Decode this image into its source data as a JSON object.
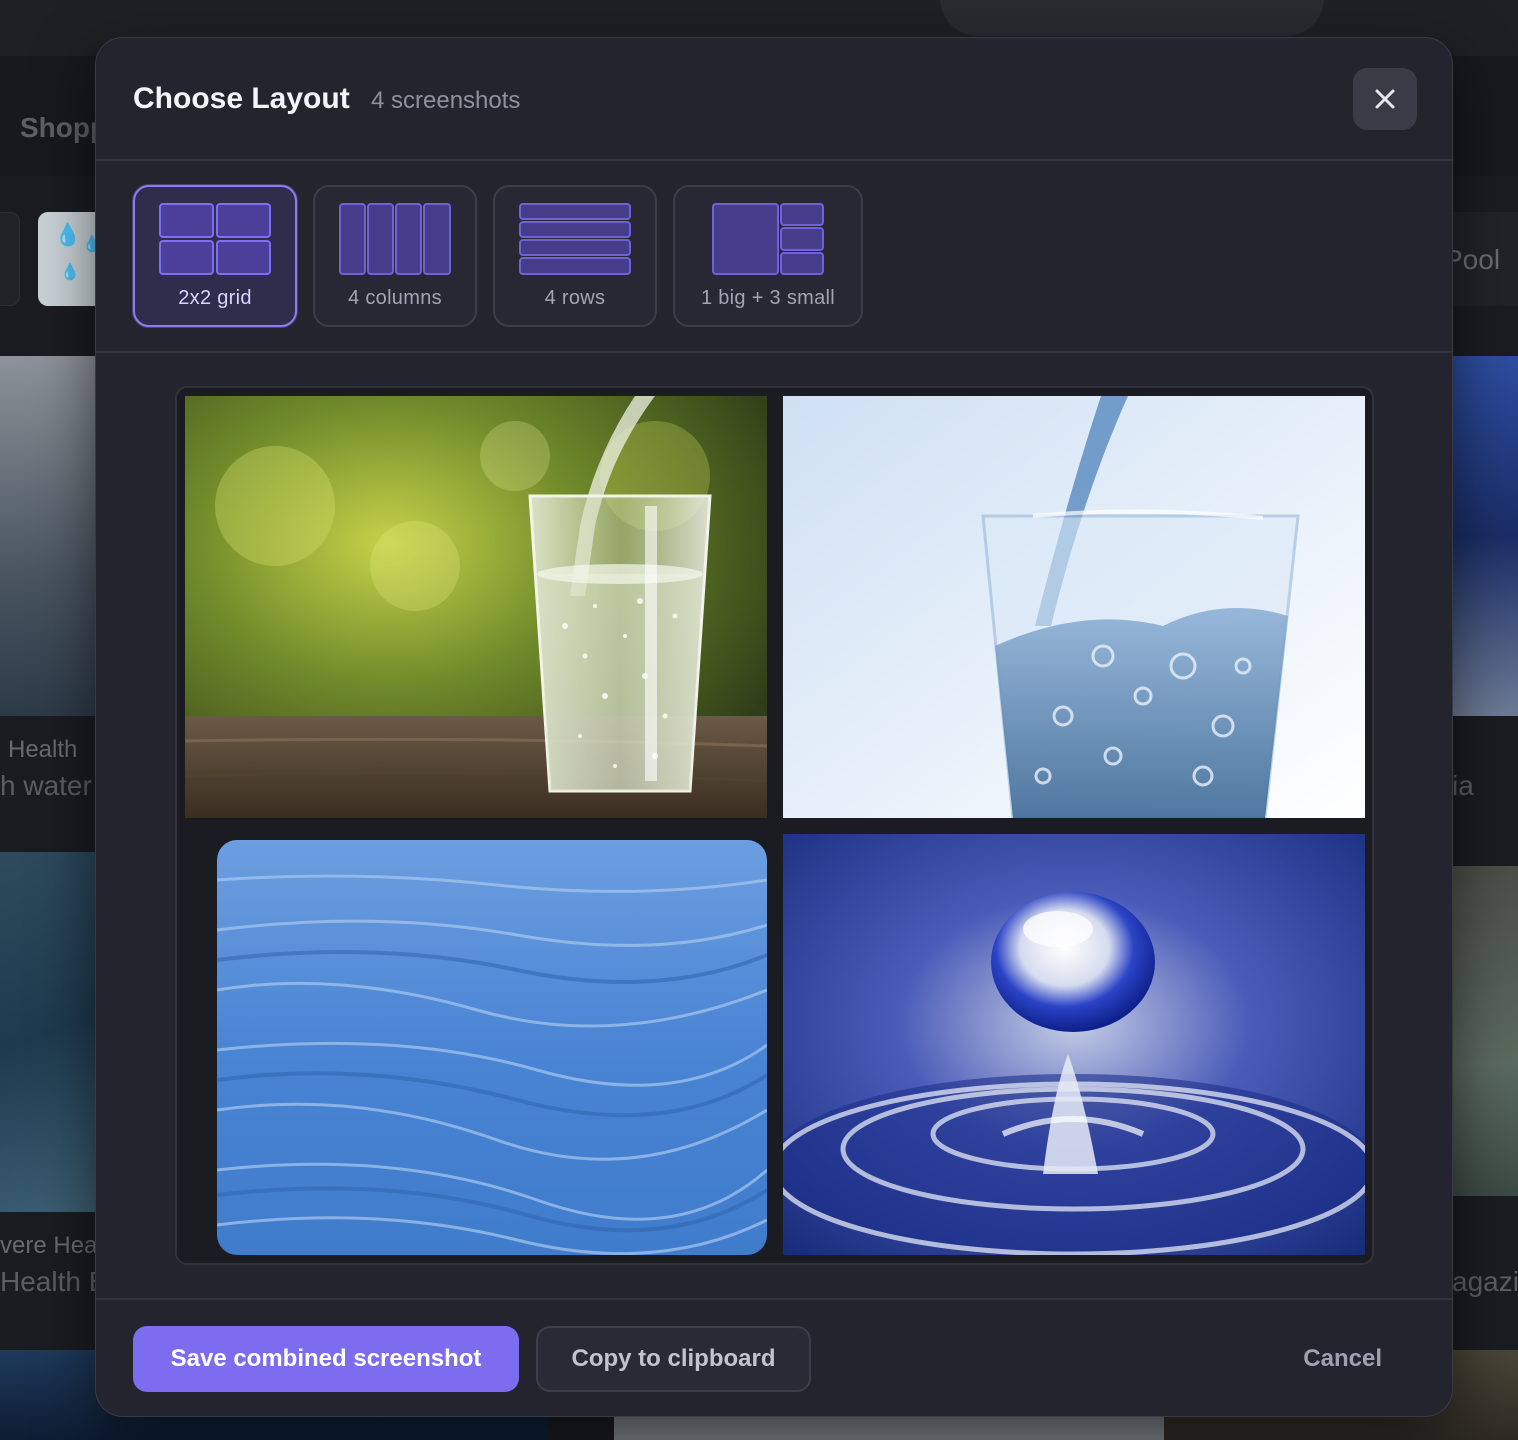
{
  "background": {
    "nav_label": "Shopp",
    "chip_right_label": "Pool",
    "card_left_1_category": "Health",
    "card_left_1_title": "h water",
    "card_right_1_title": "ia",
    "card_left_2_category": "vere Hea",
    "card_left_2_title": "Health E",
    "card_right_2_title": "agazi"
  },
  "modal": {
    "title": "Choose Layout",
    "subtitle": "4 screenshots",
    "close_icon": "close-icon",
    "layouts": [
      {
        "id": "grid",
        "label": "2x2 grid",
        "selected": true
      },
      {
        "id": "columns",
        "label": "4 columns",
        "selected": false
      },
      {
        "id": "rows",
        "label": "4 rows",
        "selected": false
      },
      {
        "id": "big",
        "label": "1 big + 3 small",
        "selected": false
      }
    ],
    "preview": {
      "tiles": [
        {
          "name": "glass-pour-green-background"
        },
        {
          "name": "glass-pour-blue-background"
        },
        {
          "name": "blue-water-waves"
        },
        {
          "name": "water-droplet-splash"
        }
      ]
    },
    "footer": {
      "save_label": "Save combined screenshot",
      "copy_label": "Copy to clipboard",
      "cancel_label": "Cancel"
    }
  },
  "colors": {
    "accent": "#7b6cf0",
    "modal_bg": "#24242f",
    "selected_border": "#8b7cf5"
  }
}
